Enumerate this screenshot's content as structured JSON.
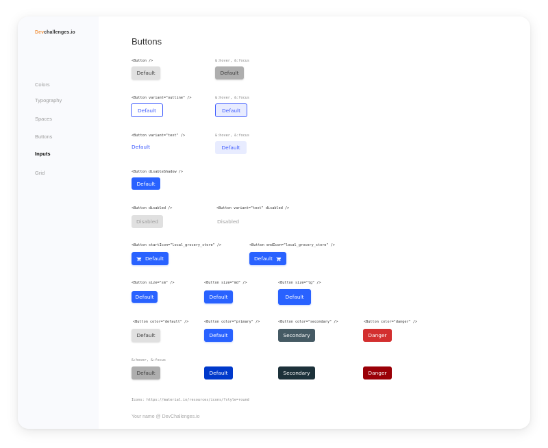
{
  "brand": {
    "accent": "Dev",
    "rest": "challenges.io"
  },
  "nav": [
    {
      "label": "Colors"
    },
    {
      "label": "Typography"
    },
    {
      "label": "Spaces"
    },
    {
      "label": "Buttons"
    },
    {
      "label": "Inputs"
    },
    {
      "label": "Grid"
    }
  ],
  "title": "Buttons",
  "hover_focus": "&:hover, &:focus",
  "default_label": "Default",
  "disabled_label": "Disabled",
  "secondary_label": "Secondary",
  "danger_label": "Danger",
  "rows": {
    "plain": "<Button />",
    "outline": "<Button variant=\"outline\" />",
    "text": "<Button variant=\"text\" />",
    "disable_shadow": "<Button disableShadow />",
    "disabled": "<Button disabled />",
    "text_disabled": "<Button variant=\"text\" disabled />",
    "start_icon": "<Button startIcon=\"local_grocery_store\" />",
    "end_icon": "<Button endIcon=\"local_grocery_store\" />",
    "size_sm": "<Button size=\"sm\" />",
    "size_md": "<Button size=\"md\" />",
    "size_lg": "<Button size=\"lg\" />",
    "color_default": "<Button color=\"default\" />",
    "color_primary": "<Button color=\"primary\" />",
    "color_secondary": "<Button color=\"secondary\" />",
    "color_danger": "<Button color=\"danger\" />"
  },
  "icons_note": "Icons: https://material.io/resources/icons/?style=round",
  "credit": "Your name  @ DevChallenges.io",
  "icon_names": [
    "cart-icon"
  ],
  "colors": {
    "primary": "#2962ff",
    "primary_hover": "#0039cb",
    "secondary": "#455a64",
    "secondary_hover": "#1c313a",
    "danger": "#d32f2f",
    "danger_hover": "#9a0007",
    "default": "#e0e0e0",
    "default_hover": "#aeaeae"
  }
}
